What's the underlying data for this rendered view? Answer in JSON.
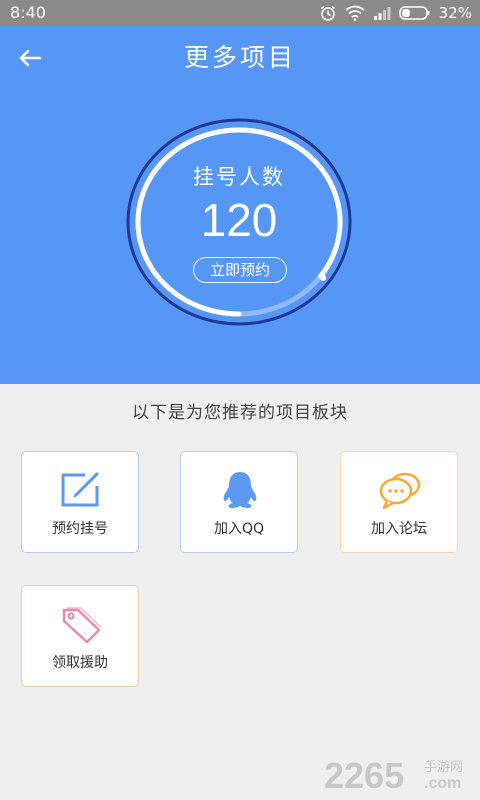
{
  "status_bar": {
    "time": "8:40",
    "battery": "32%"
  },
  "header": {
    "title": "更多项目"
  },
  "counter": {
    "label": "挂号人数",
    "count": "120",
    "progress": 0.85,
    "reserve_label": "立即预约"
  },
  "recommend": {
    "title": "以下是为您推荐的项目板块",
    "items": [
      {
        "label": "预约挂号",
        "icon": "edit-icon"
      },
      {
        "label": "加入QQ",
        "icon": "qq-penguin-icon"
      },
      {
        "label": "加入论坛",
        "icon": "chat-bubbles-icon"
      },
      {
        "label": "领取援助",
        "icon": "tag-icon"
      }
    ]
  },
  "watermark": {
    "number": "2265",
    "suffix": "手游网",
    "domain": ".com"
  },
  "colors": {
    "header_blue": "#5697f5",
    "ring_dark": "#1d3a96",
    "edit_icon": "#5b9af0",
    "qq_icon": "#5b9af0",
    "chat_icon": "#f6ac35",
    "tag_icon": "#ee8bab"
  }
}
